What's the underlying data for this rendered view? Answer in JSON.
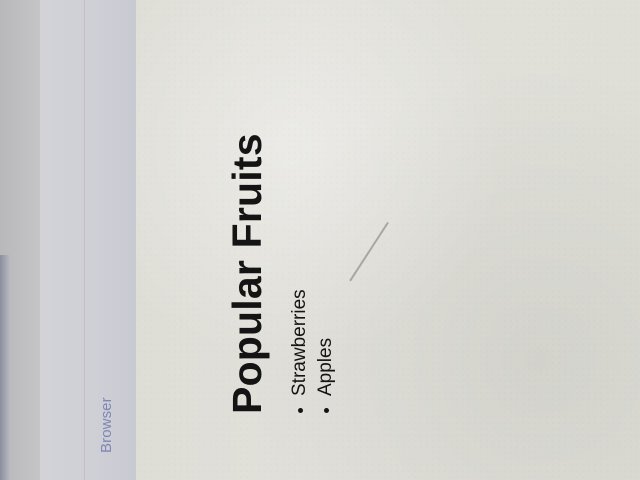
{
  "browser": {
    "label": "Browser"
  },
  "page": {
    "title": "Popular Fruits",
    "fruits": [
      "Strawberries",
      "Apples"
    ]
  }
}
